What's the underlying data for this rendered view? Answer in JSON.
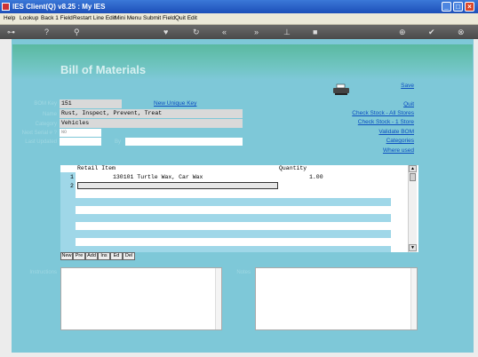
{
  "window": {
    "title": "IES Client(Q) v8.25 : My IES"
  },
  "menu": [
    "Help",
    "Lookup",
    "Back 1 Field",
    "Restart Line Edit",
    "Mini Menu",
    "Submit Field",
    "Quit Edit"
  ],
  "page": {
    "title": "Bill of Materials"
  },
  "form": {
    "bom_key_label": "BOM Key",
    "bom_key_value": "151",
    "new_unique_key": "New Unique Key",
    "name_label": "Name",
    "name_value": "Rust, Inspect, Prevent, Treat",
    "category_label": "Category",
    "category_value": "Vehicles",
    "next_serial_label": "Next Serial # ?",
    "next_serial_value": "NO",
    "last_updated_label": "Last Updated",
    "by_label": "By"
  },
  "links": [
    "Save",
    "Quit",
    "Check Stock - All Stores",
    "Check Stock - 1 Store",
    "Validate BOM",
    "Categories",
    "Where used"
  ],
  "grid": {
    "columns": [
      "Retail Item",
      "Quantity"
    ],
    "rows": [
      {
        "num": "1",
        "item": "130101 Turtle Wax, Car Wax",
        "qty": "1.00"
      },
      {
        "num": "2",
        "item": "",
        "qty": ""
      }
    ],
    "buttons": [
      "New",
      "Pre",
      "Add",
      "Ins",
      "Ed",
      "Del"
    ]
  },
  "instructions_label": "Instructions",
  "notes_label": "Notes"
}
